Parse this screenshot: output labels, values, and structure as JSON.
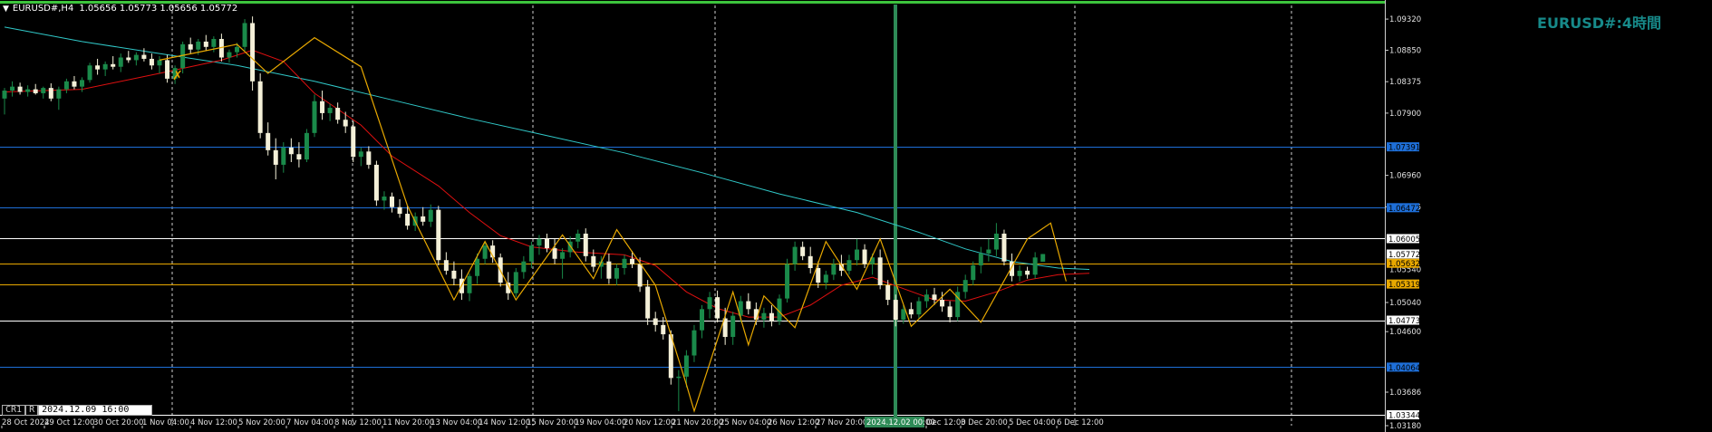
{
  "header": {
    "symbol": "EURUSD#,H4",
    "ohlc": "1.05656 1.05773 1.05656 1.05772"
  },
  "watermark": "EURUSD#:4時間",
  "cursor_box": {
    "tab1": "CR1",
    "tab2": "R",
    "time": "2024.12.09 16:00"
  },
  "colors": {
    "background": "#000000",
    "bull": "#1a8a4a",
    "bear": "#f4f0d8",
    "ma_fast": "#e01010",
    "ma_slow": "#30c8c8",
    "zigzag": "#e8a800",
    "blue_level": "#1e6fd8",
    "orange_level": "#e8a800",
    "white_level": "#ffffff",
    "green_border": "#3cc43c",
    "vline": "#2e8b57"
  },
  "chart_data": {
    "type": "candlestick",
    "symbol": "EURUSD#",
    "timeframe": "H4",
    "ylim": [
      1.0318,
      1.0954
    ],
    "price_ticks": [
      "1.09320",
      "1.08850",
      "1.08375",
      "1.07900",
      "1.06960",
      "1.06485",
      "1.05040",
      "1.04600",
      "1.03686",
      "1.03180"
    ],
    "time_labels": [
      "28 Oct 2024",
      "29 Oct 12:00",
      "30 Oct 20:00",
      "1 Nov 04:00",
      "4 Nov 12:00",
      "5 Nov 20:00",
      "7 Nov 04:00",
      "8 Nov 12:00",
      "11 Nov 20:00",
      "13 Nov 04:00",
      "14 Nov 12:00",
      "15 Nov 20:00",
      "19 Nov 04:00",
      "20 Nov 12:00",
      "21 Nov 20:00",
      "25 Nov 04:00",
      "26 Nov 12:00",
      "27 Nov 20:00",
      "2024.12.02 00:00",
      "Dec 12:00",
      "3 Dec 20:00",
      "5 Dec 04:00",
      "6 Dec 12:00"
    ],
    "horizontal_levels": [
      {
        "price": 1.07391,
        "label": "1.07391",
        "kind": "blue"
      },
      {
        "price": 1.06472,
        "label": "1.06472",
        "kind": "blue"
      },
      {
        "price": 1.06005,
        "label": "1.06005",
        "kind": "white"
      },
      {
        "price": 1.05632,
        "label": "1.05632",
        "kind": "orange"
      },
      {
        "price": 1.05319,
        "label": "1.05319",
        "kind": "orange"
      },
      {
        "price": 1.04773,
        "label": "1.04773",
        "kind": "white"
      },
      {
        "price": 1.04064,
        "label": "1.04064",
        "kind": "blue"
      },
      {
        "price": 1.03344,
        "label": "1.03344",
        "kind": "white"
      }
    ],
    "current_price": {
      "price": 1.05772,
      "label": "1.05772"
    },
    "extra_tick": {
      "price": 1.0554,
      "label": "1.05540"
    },
    "vertical_marker": "2024.12.02 00:00",
    "candles": [
      {
        "o": 1.0812,
        "h": 1.0828,
        "l": 1.0788,
        "c": 1.0824
      },
      {
        "o": 1.0824,
        "h": 1.0838,
        "l": 1.0815,
        "c": 1.083
      },
      {
        "o": 1.083,
        "h": 1.0836,
        "l": 1.0818,
        "c": 1.0822
      },
      {
        "o": 1.0822,
        "h": 1.0832,
        "l": 1.0815,
        "c": 1.0826
      },
      {
        "o": 1.0826,
        "h": 1.0834,
        "l": 1.0818,
        "c": 1.082
      },
      {
        "o": 1.082,
        "h": 1.083,
        "l": 1.0812,
        "c": 1.0828
      },
      {
        "o": 1.0828,
        "h": 1.0835,
        "l": 1.0808,
        "c": 1.0812
      },
      {
        "o": 1.0812,
        "h": 1.083,
        "l": 1.0795,
        "c": 1.0826
      },
      {
        "o": 1.0826,
        "h": 1.0842,
        "l": 1.082,
        "c": 1.0838
      },
      {
        "o": 1.0838,
        "h": 1.0846,
        "l": 1.0826,
        "c": 1.083
      },
      {
        "o": 1.083,
        "h": 1.0844,
        "l": 1.0822,
        "c": 1.084
      },
      {
        "o": 1.084,
        "h": 1.0866,
        "l": 1.0836,
        "c": 1.0862
      },
      {
        "o": 1.0862,
        "h": 1.0872,
        "l": 1.0848,
        "c": 1.0856
      },
      {
        "o": 1.0856,
        "h": 1.0868,
        "l": 1.0846,
        "c": 1.0864
      },
      {
        "o": 1.0864,
        "h": 1.0876,
        "l": 1.0856,
        "c": 1.086
      },
      {
        "o": 1.086,
        "h": 1.088,
        "l": 1.0852,
        "c": 1.0874
      },
      {
        "o": 1.0874,
        "h": 1.0884,
        "l": 1.0866,
        "c": 1.087
      },
      {
        "o": 1.087,
        "h": 1.0882,
        "l": 1.0862,
        "c": 1.0878
      },
      {
        "o": 1.0878,
        "h": 1.0888,
        "l": 1.0868,
        "c": 1.0872
      },
      {
        "o": 1.0872,
        "h": 1.088,
        "l": 1.0856,
        "c": 1.0862
      },
      {
        "o": 1.0862,
        "h": 1.0876,
        "l": 1.085,
        "c": 1.087
      },
      {
        "o": 1.087,
        "h": 1.0878,
        "l": 1.0836,
        "c": 1.0842
      },
      {
        "o": 1.0842,
        "h": 1.0862,
        "l": 1.0834,
        "c": 1.0858
      },
      {
        "o": 1.0858,
        "h": 1.0898,
        "l": 1.085,
        "c": 1.0894
      },
      {
        "o": 1.0894,
        "h": 1.0904,
        "l": 1.088,
        "c": 1.0886
      },
      {
        "o": 1.0886,
        "h": 1.0902,
        "l": 1.0878,
        "c": 1.0898
      },
      {
        "o": 1.0898,
        "h": 1.0908,
        "l": 1.0884,
        "c": 1.089
      },
      {
        "o": 1.089,
        "h": 1.0906,
        "l": 1.0882,
        "c": 1.0902
      },
      {
        "o": 1.0902,
        "h": 1.091,
        "l": 1.0868,
        "c": 1.0874
      },
      {
        "o": 1.0874,
        "h": 1.0886,
        "l": 1.0866,
        "c": 1.0882
      },
      {
        "o": 1.0882,
        "h": 1.0896,
        "l": 1.0874,
        "c": 1.089
      },
      {
        "o": 1.089,
        "h": 1.0932,
        "l": 1.0884,
        "c": 1.0926
      },
      {
        "o": 1.0926,
        "h": 1.0936,
        "l": 1.0824,
        "c": 1.0838
      },
      {
        "o": 1.0838,
        "h": 1.085,
        "l": 1.0752,
        "c": 1.076
      },
      {
        "o": 1.076,
        "h": 1.0776,
        "l": 1.0726,
        "c": 1.0734
      },
      {
        "o": 1.0734,
        "h": 1.0752,
        "l": 1.069,
        "c": 1.0712
      },
      {
        "o": 1.0712,
        "h": 1.0746,
        "l": 1.07,
        "c": 1.0738
      },
      {
        "o": 1.0738,
        "h": 1.0752,
        "l": 1.0716,
        "c": 1.0728
      },
      {
        "o": 1.0728,
        "h": 1.0746,
        "l": 1.0708,
        "c": 1.072
      },
      {
        "o": 1.072,
        "h": 1.0766,
        "l": 1.0716,
        "c": 1.076
      },
      {
        "o": 1.076,
        "h": 1.0818,
        "l": 1.0754,
        "c": 1.0808
      },
      {
        "o": 1.0808,
        "h": 1.0824,
        "l": 1.078,
        "c": 1.079
      },
      {
        "o": 1.079,
        "h": 1.0804,
        "l": 1.0778,
        "c": 1.0798
      },
      {
        "o": 1.0798,
        "h": 1.0806,
        "l": 1.0774,
        "c": 1.078
      },
      {
        "o": 1.078,
        "h": 1.0792,
        "l": 1.076,
        "c": 1.077
      },
      {
        "o": 1.077,
        "h": 1.0778,
        "l": 1.0716,
        "c": 1.0724
      },
      {
        "o": 1.0724,
        "h": 1.0738,
        "l": 1.071,
        "c": 1.0732
      },
      {
        "o": 1.0732,
        "h": 1.074,
        "l": 1.0706,
        "c": 1.0712
      },
      {
        "o": 1.0712,
        "h": 1.0718,
        "l": 1.065,
        "c": 1.0658
      },
      {
        "o": 1.0658,
        "h": 1.0672,
        "l": 1.0644,
        "c": 1.0664
      },
      {
        "o": 1.0664,
        "h": 1.067,
        "l": 1.064,
        "c": 1.0648
      },
      {
        "o": 1.0648,
        "h": 1.066,
        "l": 1.0632,
        "c": 1.0638
      },
      {
        "o": 1.0638,
        "h": 1.065,
        "l": 1.0614,
        "c": 1.062
      },
      {
        "o": 1.062,
        "h": 1.064,
        "l": 1.0612,
        "c": 1.0634
      },
      {
        "o": 1.0634,
        "h": 1.0648,
        "l": 1.062,
        "c": 1.0626
      },
      {
        "o": 1.0626,
        "h": 1.0652,
        "l": 1.0618,
        "c": 1.0644
      },
      {
        "o": 1.0644,
        "h": 1.065,
        "l": 1.056,
        "c": 1.0568
      },
      {
        "o": 1.0568,
        "h": 1.058,
        "l": 1.0546,
        "c": 1.0552
      },
      {
        "o": 1.0552,
        "h": 1.0566,
        "l": 1.053,
        "c": 1.054
      },
      {
        "o": 1.054,
        "h": 1.0554,
        "l": 1.0508,
        "c": 1.0518
      },
      {
        "o": 1.0518,
        "h": 1.0548,
        "l": 1.0506,
        "c": 1.0544
      },
      {
        "o": 1.0544,
        "h": 1.0578,
        "l": 1.0532,
        "c": 1.057
      },
      {
        "o": 1.057,
        "h": 1.0596,
        "l": 1.0562,
        "c": 1.059
      },
      {
        "o": 1.059,
        "h": 1.0598,
        "l": 1.0564,
        "c": 1.0572
      },
      {
        "o": 1.0572,
        "h": 1.0578,
        "l": 1.0528,
        "c": 1.0534
      },
      {
        "o": 1.0534,
        "h": 1.055,
        "l": 1.0508,
        "c": 1.0518
      },
      {
        "o": 1.0518,
        "h": 1.0556,
        "l": 1.0512,
        "c": 1.055
      },
      {
        "o": 1.055,
        "h": 1.0574,
        "l": 1.054,
        "c": 1.0566
      },
      {
        "o": 1.0566,
        "h": 1.0596,
        "l": 1.0556,
        "c": 1.059
      },
      {
        "o": 1.059,
        "h": 1.0606,
        "l": 1.0576,
        "c": 1.06
      },
      {
        "o": 1.06,
        "h": 1.0608,
        "l": 1.058,
        "c": 1.0586
      },
      {
        "o": 1.0586,
        "h": 1.06,
        "l": 1.0562,
        "c": 1.057
      },
      {
        "o": 1.057,
        "h": 1.0586,
        "l": 1.054,
        "c": 1.058
      },
      {
        "o": 1.058,
        "h": 1.0604,
        "l": 1.0572,
        "c": 1.0596
      },
      {
        "o": 1.0596,
        "h": 1.0614,
        "l": 1.0586,
        "c": 1.0608
      },
      {
        "o": 1.0608,
        "h": 1.0616,
        "l": 1.0566,
        "c": 1.0574
      },
      {
        "o": 1.0574,
        "h": 1.0584,
        "l": 1.055,
        "c": 1.0558
      },
      {
        "o": 1.0558,
        "h": 1.0574,
        "l": 1.054,
        "c": 1.0566
      },
      {
        "o": 1.0566,
        "h": 1.0578,
        "l": 1.0532,
        "c": 1.054
      },
      {
        "o": 1.054,
        "h": 1.0562,
        "l": 1.053,
        "c": 1.0556
      },
      {
        "o": 1.0556,
        "h": 1.0576,
        "l": 1.0546,
        "c": 1.057
      },
      {
        "o": 1.057,
        "h": 1.0582,
        "l": 1.0556,
        "c": 1.0562
      },
      {
        "o": 1.0562,
        "h": 1.0572,
        "l": 1.052,
        "c": 1.0528
      },
      {
        "o": 1.0528,
        "h": 1.0538,
        "l": 1.047,
        "c": 1.048
      },
      {
        "o": 1.048,
        "h": 1.049,
        "l": 1.046,
        "c": 1.047
      },
      {
        "o": 1.047,
        "h": 1.0482,
        "l": 1.0448,
        "c": 1.0456
      },
      {
        "o": 1.0456,
        "h": 1.0462,
        "l": 1.038,
        "c": 1.039
      },
      {
        "o": 1.039,
        "h": 1.0402,
        "l": 1.034,
        "c": 1.0392
      },
      {
        "o": 1.0392,
        "h": 1.0432,
        "l": 1.0376,
        "c": 1.0424
      },
      {
        "o": 1.0424,
        "h": 1.047,
        "l": 1.0414,
        "c": 1.0462
      },
      {
        "o": 1.0462,
        "h": 1.05,
        "l": 1.045,
        "c": 1.0494
      },
      {
        "o": 1.0494,
        "h": 1.052,
        "l": 1.048,
        "c": 1.0512
      },
      {
        "o": 1.0512,
        "h": 1.0522,
        "l": 1.0474,
        "c": 1.048
      },
      {
        "o": 1.048,
        "h": 1.0496,
        "l": 1.044,
        "c": 1.0452
      },
      {
        "o": 1.0452,
        "h": 1.049,
        "l": 1.044,
        "c": 1.0484
      },
      {
        "o": 1.0484,
        "h": 1.0514,
        "l": 1.0474,
        "c": 1.0506
      },
      {
        "o": 1.0506,
        "h": 1.0518,
        "l": 1.0486,
        "c": 1.0494
      },
      {
        "o": 1.0494,
        "h": 1.0504,
        "l": 1.047,
        "c": 1.0478
      },
      {
        "o": 1.0478,
        "h": 1.0496,
        "l": 1.0466,
        "c": 1.0488
      },
      {
        "o": 1.0488,
        "h": 1.05,
        "l": 1.0468,
        "c": 1.0476
      },
      {
        "o": 1.0476,
        "h": 1.0516,
        "l": 1.047,
        "c": 1.051
      },
      {
        "o": 1.051,
        "h": 1.057,
        "l": 1.0504,
        "c": 1.0562
      },
      {
        "o": 1.0562,
        "h": 1.0596,
        "l": 1.0552,
        "c": 1.0588
      },
      {
        "o": 1.0588,
        "h": 1.0596,
        "l": 1.0568,
        "c": 1.0574
      },
      {
        "o": 1.0574,
        "h": 1.0588,
        "l": 1.0548,
        "c": 1.0556
      },
      {
        "o": 1.0556,
        "h": 1.0566,
        "l": 1.0526,
        "c": 1.0534
      },
      {
        "o": 1.0534,
        "h": 1.0552,
        "l": 1.0524,
        "c": 1.0546
      },
      {
        "o": 1.0546,
        "h": 1.057,
        "l": 1.0538,
        "c": 1.0562
      },
      {
        "o": 1.0562,
        "h": 1.0576,
        "l": 1.0544,
        "c": 1.0552
      },
      {
        "o": 1.0552,
        "h": 1.0576,
        "l": 1.0546,
        "c": 1.0568
      },
      {
        "o": 1.0568,
        "h": 1.06,
        "l": 1.056,
        "c": 1.0584
      },
      {
        "o": 1.0584,
        "h": 1.0592,
        "l": 1.0556,
        "c": 1.0562
      },
      {
        "o": 1.0562,
        "h": 1.0578,
        "l": 1.0546,
        "c": 1.0572
      },
      {
        "o": 1.0572,
        "h": 1.0584,
        "l": 1.0524,
        "c": 1.053
      },
      {
        "o": 1.053,
        "h": 1.0538,
        "l": 1.05,
        "c": 1.0508
      },
      {
        "o": 1.0508,
        "h": 1.0516,
        "l": 1.0468,
        "c": 1.0478
      },
      {
        "o": 1.0478,
        "h": 1.05,
        "l": 1.0472,
        "c": 1.0494
      },
      {
        "o": 1.0494,
        "h": 1.0504,
        "l": 1.048,
        "c": 1.0486
      },
      {
        "o": 1.0486,
        "h": 1.0512,
        "l": 1.048,
        "c": 1.0506
      },
      {
        "o": 1.0506,
        "h": 1.0524,
        "l": 1.0496,
        "c": 1.0516
      },
      {
        "o": 1.0516,
        "h": 1.0526,
        "l": 1.05,
        "c": 1.0508
      },
      {
        "o": 1.0508,
        "h": 1.052,
        "l": 1.049,
        "c": 1.0498
      },
      {
        "o": 1.0498,
        "h": 1.0506,
        "l": 1.0474,
        "c": 1.0482
      },
      {
        "o": 1.0482,
        "h": 1.0528,
        "l": 1.0476,
        "c": 1.052
      },
      {
        "o": 1.052,
        "h": 1.0546,
        "l": 1.051,
        "c": 1.0538
      },
      {
        "o": 1.0538,
        "h": 1.0566,
        "l": 1.053,
        "c": 1.056
      },
      {
        "o": 1.056,
        "h": 1.0588,
        "l": 1.0548,
        "c": 1.0578
      },
      {
        "o": 1.0578,
        "h": 1.06,
        "l": 1.0566,
        "c": 1.0584
      },
      {
        "o": 1.0584,
        "h": 1.0624,
        "l": 1.0574,
        "c": 1.0608
      },
      {
        "o": 1.0608,
        "h": 1.0614,
        "l": 1.056,
        "c": 1.0566
      },
      {
        "o": 1.0566,
        "h": 1.0578,
        "l": 1.0536,
        "c": 1.0544
      },
      {
        "o": 1.0544,
        "h": 1.056,
        "l": 1.0536,
        "c": 1.0552
      },
      {
        "o": 1.0552,
        "h": 1.0558,
        "l": 1.054,
        "c": 1.0546
      },
      {
        "o": 1.0546,
        "h": 1.058,
        "l": 1.054,
        "c": 1.0572
      },
      {
        "o": 1.05656,
        "h": 1.05773,
        "l": 1.05656,
        "c": 1.05772
      }
    ],
    "ma_slow": [
      [
        0,
        1.092
      ],
      [
        10,
        1.0898
      ],
      [
        20,
        1.088
      ],
      [
        30,
        1.0862
      ],
      [
        40,
        1.0838
      ],
      [
        50,
        1.081
      ],
      [
        60,
        1.0782
      ],
      [
        70,
        1.0756
      ],
      [
        80,
        1.073
      ],
      [
        90,
        1.07
      ],
      [
        100,
        1.0668
      ],
      [
        110,
        1.064
      ],
      [
        118,
        1.061
      ],
      [
        124,
        1.0585
      ],
      [
        130,
        1.0566
      ],
      [
        136,
        1.0556
      ],
      [
        140,
        1.0554
      ]
    ],
    "ma_fast": [
      [
        0,
        1.0822
      ],
      [
        10,
        1.0826
      ],
      [
        20,
        1.085
      ],
      [
        28,
        1.087
      ],
      [
        32,
        1.0885
      ],
      [
        36,
        1.0868
      ],
      [
        40,
        1.082
      ],
      [
        46,
        1.0772
      ],
      [
        50,
        1.0725
      ],
      [
        56,
        1.068
      ],
      [
        60,
        1.064
      ],
      [
        64,
        1.0605
      ],
      [
        68,
        1.0588
      ],
      [
        74,
        1.058
      ],
      [
        80,
        1.0576
      ],
      [
        84,
        1.056
      ],
      [
        88,
        1.052
      ],
      [
        92,
        1.0495
      ],
      [
        96,
        1.0482
      ],
      [
        100,
        1.0482
      ],
      [
        104,
        1.05
      ],
      [
        108,
        1.053
      ],
      [
        112,
        1.0542
      ],
      [
        116,
        1.0525
      ],
      [
        120,
        1.0508
      ],
      [
        124,
        1.0506
      ],
      [
        128,
        1.052
      ],
      [
        132,
        1.0538
      ],
      [
        136,
        1.0546
      ],
      [
        140,
        1.0548
      ]
    ],
    "zigzag": [
      [
        20,
        1.087
      ],
      [
        30,
        1.0894
      ],
      [
        34,
        1.085
      ],
      [
        40,
        1.0904
      ],
      [
        46,
        1.086
      ],
      [
        52,
        1.065
      ],
      [
        58,
        1.0508
      ],
      [
        62,
        1.0596
      ],
      [
        66,
        1.0508
      ],
      [
        72,
        1.0606
      ],
      [
        76,
        1.054
      ],
      [
        79,
        1.0614
      ],
      [
        84,
        1.053
      ],
      [
        88,
        1.038
      ],
      [
        89,
        1.034
      ],
      [
        94,
        1.052
      ],
      [
        96,
        1.044
      ],
      [
        98,
        1.0514
      ],
      [
        102,
        1.0466
      ],
      [
        106,
        1.0596
      ],
      [
        110,
        1.0524
      ],
      [
        113,
        1.06
      ],
      [
        117,
        1.0468
      ],
      [
        122,
        1.0524
      ],
      [
        126,
        1.0474
      ],
      [
        132,
        1.06
      ],
      [
        135,
        1.0624
      ],
      [
        137,
        1.0536
      ]
    ]
  }
}
